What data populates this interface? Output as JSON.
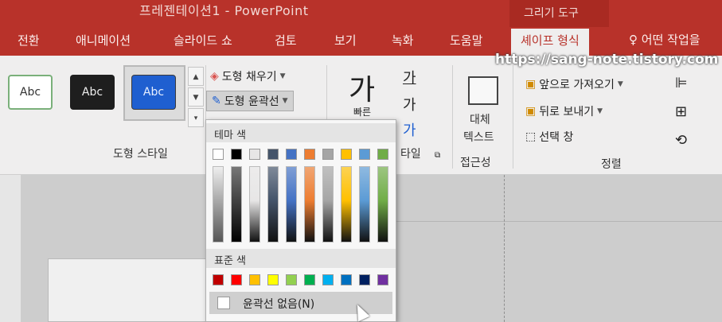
{
  "titlebar": {
    "doc_title": "프레젠테이션1  -  PowerPoint",
    "context_title": "그리기 도구"
  },
  "tabs": [
    "전환",
    "애니메이션",
    "슬라이드 쇼",
    "검토",
    "보기",
    "녹화",
    "도움말"
  ],
  "active_tab": "셰이프 형식",
  "tell_me": "어떤 작업을",
  "watermark": "https://sang-note.tistory.com",
  "shape_styles": {
    "thumb_label": "Abc",
    "group_label": "도형 스타일"
  },
  "shape_commands": {
    "fill": "도형 채우기",
    "outline": "도형 윤곽선"
  },
  "wordart": {
    "glyph_big": "가",
    "glyph_small": "가",
    "under_text": "빠른",
    "group_label_suffix": "타일"
  },
  "accessibility": {
    "alt_text_line1": "대체",
    "alt_text_line2": "텍스트",
    "group_label": "접근성"
  },
  "arrange": {
    "bring_forward": "앞으로 가져오기",
    "send_backward": "뒤로 보내기",
    "selection_pane": "선택 창",
    "group_label": "정렬"
  },
  "dropdown": {
    "theme_header": "테마 색",
    "standard_header": "표준 색",
    "no_outline": "윤곽선 없음(N)",
    "theme_colors": [
      "#ffffff",
      "#000000",
      "#e7e6e6",
      "#44546a",
      "#4472c4",
      "#ed7d31",
      "#a5a5a5",
      "#ffc000",
      "#5b9bd5",
      "#70ad47"
    ],
    "standard_colors": [
      "#c00000",
      "#ff0000",
      "#ffc000",
      "#ffff00",
      "#92d050",
      "#00b050",
      "#00b0f0",
      "#0070c0",
      "#002060",
      "#7030a0"
    ]
  },
  "colors": {
    "accent": "#b8322a",
    "ribbon_bg": "#efeeee"
  }
}
